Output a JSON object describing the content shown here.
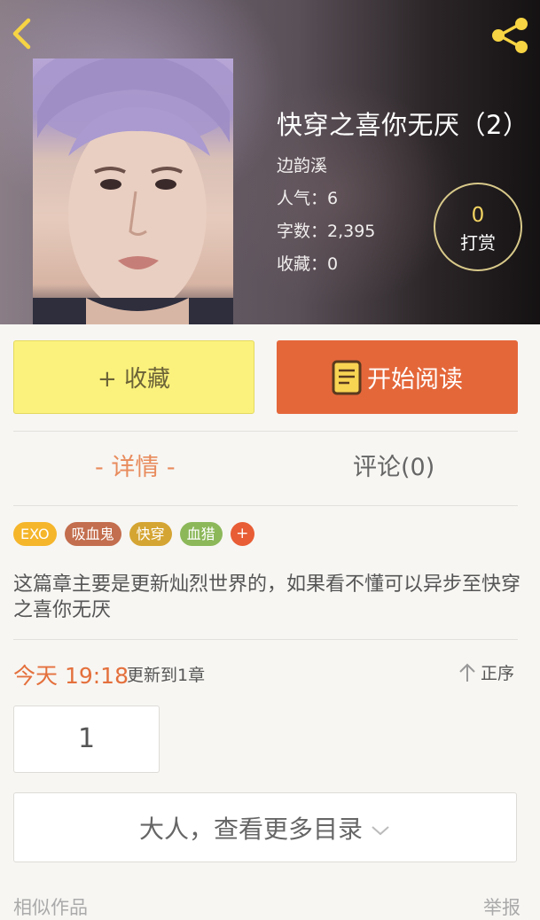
{
  "header": {
    "back_icon": "chevron-left-icon",
    "share_icon": "share-icon"
  },
  "book": {
    "title": "快穿之喜你无厌（2）",
    "author": "边韵溪",
    "popularity": "人气：6",
    "word_count": "字数：2,395",
    "favorites": "收藏：0"
  },
  "tip": {
    "count": "0",
    "label": "打赏"
  },
  "actions": {
    "collect_label": "+ 收藏",
    "read_label": "开始阅读",
    "read_icon": "book-icon"
  },
  "tabs": {
    "detail": "- 详情 -",
    "comments": "评论(0)"
  },
  "tags": [
    {
      "label": "EXO",
      "color": "#f5b62c"
    },
    {
      "label": "吸血鬼",
      "color": "#c36e4e"
    },
    {
      "label": "快穿",
      "color": "#d5a533"
    },
    {
      "label": "血猎",
      "color": "#8cb85a"
    }
  ],
  "tag_add": "+",
  "description": "这篇章主要是更新灿烈世界的，如果看不懂可以异步至快穿之喜你无厌",
  "update": {
    "time": "今天 19:18",
    "text": "更新到1章"
  },
  "sort": {
    "label": "正序",
    "icon": "arrow-up-icon"
  },
  "chapter": "1",
  "more_catalog": "大人，查看更多目录",
  "footer": {
    "similar": "相似作品",
    "report": "举报"
  },
  "colors": {
    "accent_orange": "#e4673a",
    "collect_yellow": "#fbf27d",
    "tab_active": "#e88b5c"
  }
}
